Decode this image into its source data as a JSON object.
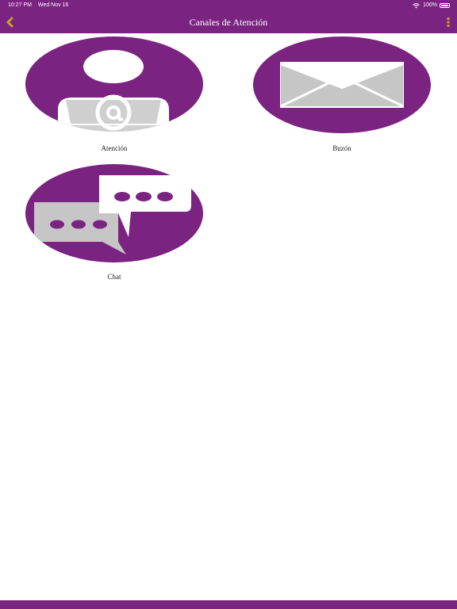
{
  "status_bar": {
    "time": "10:27 PM",
    "date": "Wed Nov 16",
    "battery": "100%"
  },
  "nav": {
    "title": "Canales de Atención",
    "back_icon": "chevron-left-icon",
    "menu_icon": "more-vertical-icon"
  },
  "colors": {
    "brand_purple": "#7a2381",
    "accent_gold": "#c8a227",
    "icon_gray": "#c6c6c6"
  },
  "channels": [
    {
      "label": "Atención",
      "icon": "user-at-icon"
    },
    {
      "label": "Buzón",
      "icon": "envelope-icon"
    },
    {
      "label": "Chat",
      "icon": "chat-bubbles-icon"
    }
  ]
}
